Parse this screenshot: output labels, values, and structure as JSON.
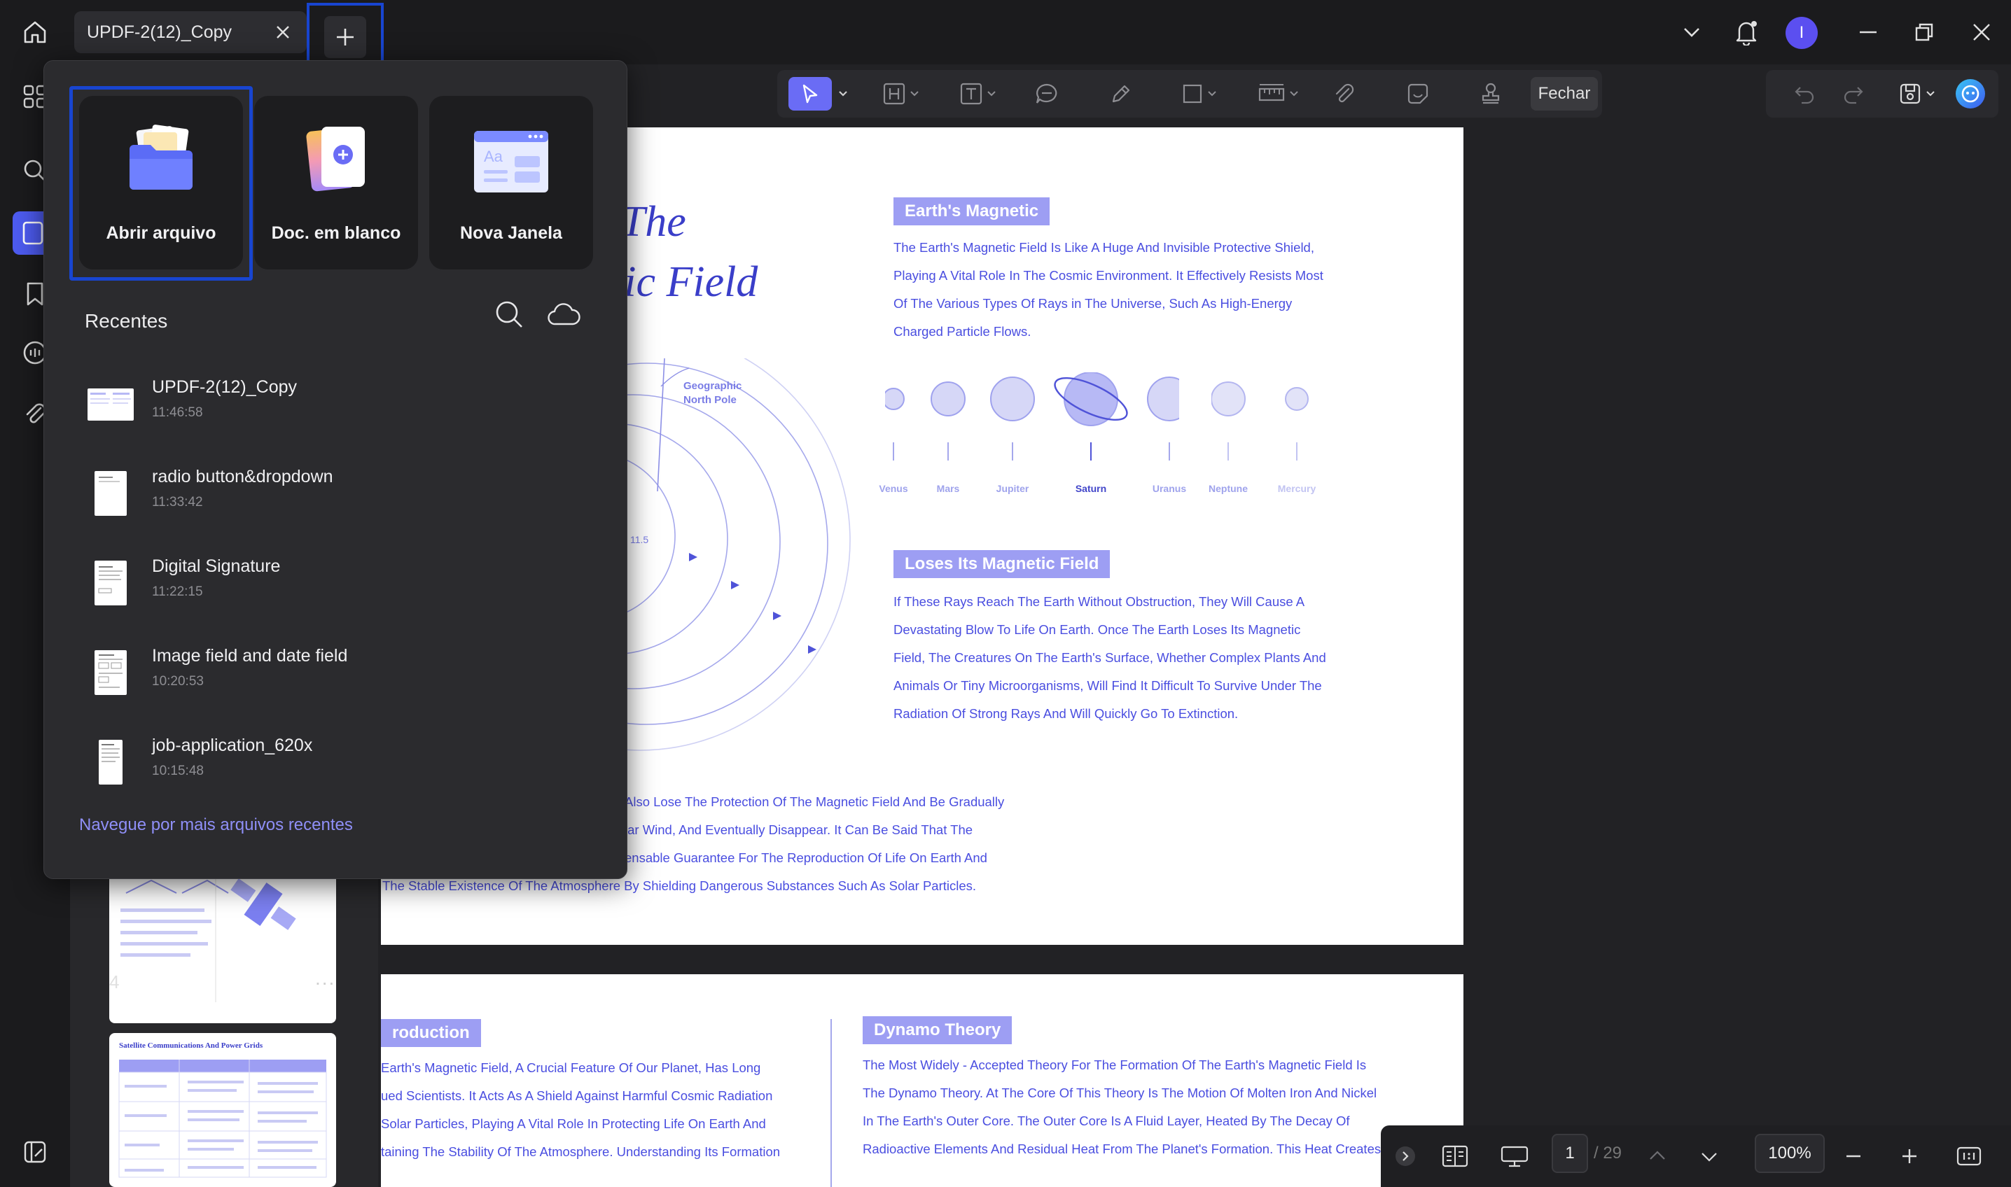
{
  "titlebar": {
    "tab_label": "UPDF-2(12)_Copy",
    "avatar_letter": "I"
  },
  "toolbar": {
    "fechar_label": "Fechar"
  },
  "popup": {
    "cards": [
      {
        "label": "Abrir arquivo",
        "icon": "folder-icon"
      },
      {
        "label": "Doc. em blanco",
        "icon": "blank-doc-icon"
      },
      {
        "label": "Nova Janela",
        "icon": "new-window-icon"
      }
    ],
    "recent_title": "Recentes",
    "recent": [
      {
        "name": "UPDF-2(12)_Copy",
        "time": "11:46:58"
      },
      {
        "name": "radio button&dropdown",
        "time": "11:33:42"
      },
      {
        "name": "Digital Signature",
        "time": "11:22:15"
      },
      {
        "name": "Image field and date field",
        "time": "10:20:53"
      },
      {
        "name": "job-application_620x",
        "time": "10:15:48"
      }
    ],
    "more_link": "Navegue por mais arquivos recentes"
  },
  "thumbs": {
    "page4_num": "4",
    "more": "...",
    "page5_title": "Satellite Communications And Power Grids"
  },
  "document": {
    "title_line1": "f The",
    "title_line2": "tic Field",
    "pole_label_1": "Geographic",
    "pole_label_2": "North Pole",
    "pole_angle": "11.5",
    "h_earth": "Earth's Magnetic",
    "p_earth": [
      "The Earth's Magnetic Field Is Like A Huge And Invisible Protective Shield,",
      "Playing A Vital Role In The Cosmic Environment. It Effectively Resists Most",
      "Of The Various Types Of Rays in The Universe, Such As High-Energy",
      "Charged Particle Flows."
    ],
    "planets": [
      "Venus",
      "Mars",
      "Jupiter",
      "Saturn",
      "Uranus",
      "Neptune",
      "Mercury"
    ],
    "h_loses": "Loses Its Magnetic Field",
    "p_loses": [
      "If These Rays Reach The Earth Without Obstruction, They Will Cause A",
      "Devastating Blow To Life On Earth. Once The Earth Loses Its Magnetic",
      "Field, The Creatures On The Earth's Surface, Whether Complex Plants And",
      "Animals Or Tiny Microorganisms, Will Find It Difficult To Survive Under The",
      "Radiation Of Strong Rays And Will Quickly Go To Extinction."
    ],
    "p_bottom": [
      "Also Lose The Protection Of The Magnetic Field And Be Gradually",
      "lar Wind, And Eventually Disappear. It Can Be Said That The",
      "ensable Guarantee For The Reproduction Of Life On Earth And",
      "The Stable Existence Of The Atmosphere By Shielding Dangerous Substances Such As Solar Particles."
    ],
    "h_intro": "roduction",
    "p_intro": [
      "Earth's Magnetic Field, A Crucial Feature Of Our Planet, Has Long",
      "ued Scientists. It Acts As A Shield Against Harmful Cosmic Radiation",
      "Solar Particles, Playing A Vital Role In Protecting Life On Earth And",
      "taining The Stability Of The Atmosphere. Understanding Its Formation"
    ],
    "h_dynamo": "Dynamo Theory",
    "p_dynamo": [
      "The Most Widely - Accepted Theory For The Formation Of The Earth's Magnetic Field Is",
      "The Dynamo Theory. At The Core Of This Theory Is The Motion Of Molten Iron And Nickel",
      "In The Earth's Outer Core. The Outer Core Is A Fluid Layer, Heated By The Decay Of",
      "Radioactive Elements And Residual Heat From The Planet's Formation. This Heat Creates"
    ]
  },
  "navbar": {
    "page_current": "1",
    "page_total": "/ 29",
    "zoom": "100%"
  },
  "colors": {
    "accent": "#6a6cf5",
    "highlight_border": "#1845d0",
    "doc_text": "#4a4ee0",
    "header_bg": "#9d9ef3"
  }
}
